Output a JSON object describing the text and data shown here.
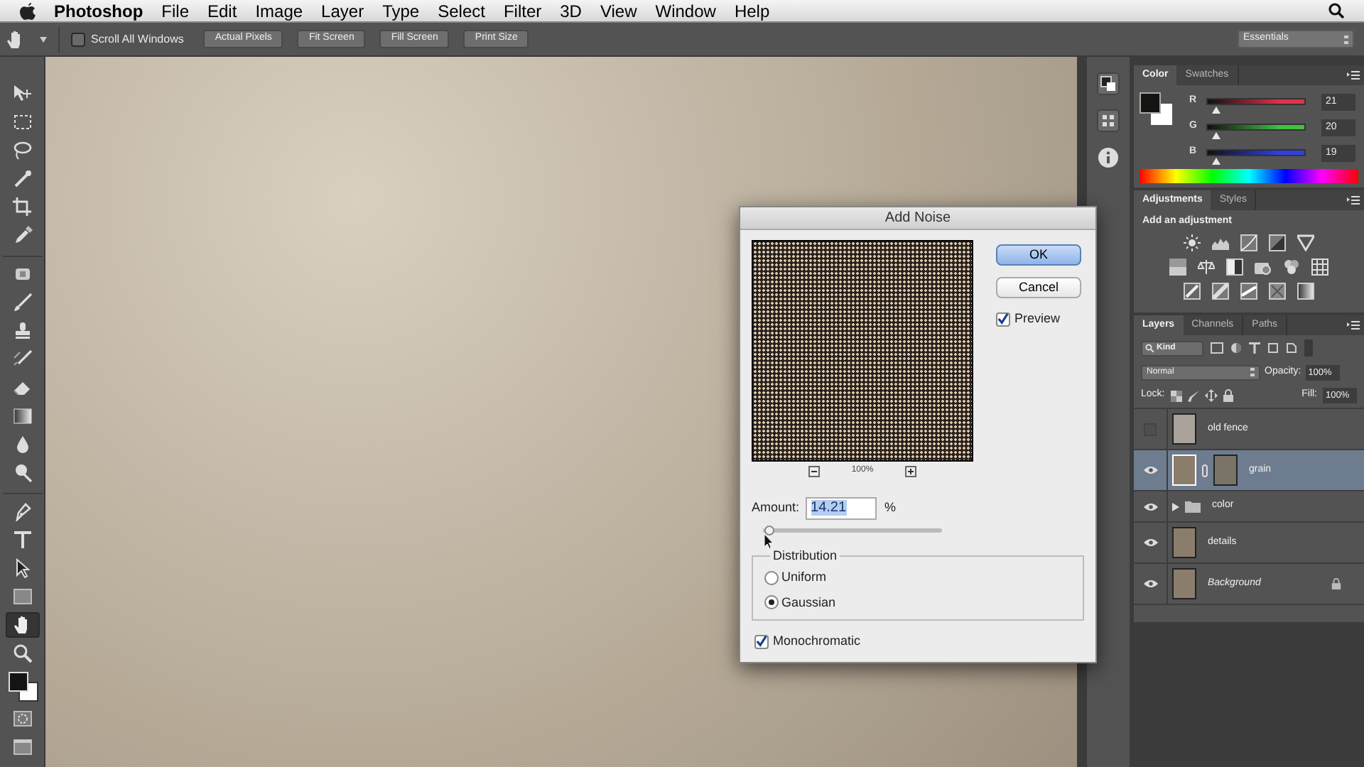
{
  "menu_bar": {
    "items": [
      "Photoshop",
      "File",
      "Edit",
      "Image",
      "Layer",
      "Type",
      "Select",
      "Filter",
      "3D",
      "View",
      "Window",
      "Help"
    ]
  },
  "options_bar": {
    "scroll_all_windows": {
      "label": "Scroll All Windows",
      "checked": false
    },
    "buttons": [
      "Actual Pixels",
      "Fit Screen",
      "Fill Screen",
      "Print Size"
    ],
    "workspace": "Essentials"
  },
  "tools": [
    {
      "kind": "move",
      "selected": false
    },
    {
      "kind": "marquee",
      "selected": false
    },
    {
      "kind": "lasso",
      "selected": false
    },
    {
      "kind": "wand",
      "selected": false
    },
    {
      "kind": "crop",
      "selected": false
    },
    {
      "kind": "eyedropper",
      "selected": false
    },
    {
      "kind": "healing",
      "selected": false
    },
    {
      "kind": "brush",
      "selected": false
    },
    {
      "kind": "stamp",
      "selected": false
    },
    {
      "kind": "historybrush",
      "selected": false
    },
    {
      "kind": "eraser",
      "selected": false
    },
    {
      "kind": "gradient",
      "selected": false
    },
    {
      "kind": "blur",
      "selected": false
    },
    {
      "kind": "dodge",
      "selected": false
    },
    {
      "kind": "pen",
      "selected": false
    },
    {
      "kind": "type",
      "selected": false
    },
    {
      "kind": "pathselect",
      "selected": false
    },
    {
      "kind": "shape",
      "selected": false
    },
    {
      "kind": "hand",
      "selected": true
    },
    {
      "kind": "zoom",
      "selected": false
    }
  ],
  "color_panel": {
    "tabs": [
      {
        "label": "Color",
        "selected": true
      },
      {
        "label": "Swatches",
        "selected": false
      }
    ],
    "channels": [
      {
        "label": "R",
        "value": "21",
        "level": 0.08,
        "color": "#e0304a"
      },
      {
        "label": "G",
        "value": "20",
        "level": 0.08,
        "color": "#40c040"
      },
      {
        "label": "B",
        "value": "19",
        "level": 0.08,
        "color": "#3040e0"
      }
    ]
  },
  "adjustments_panel": {
    "tabs": [
      {
        "label": "Adjustments",
        "selected": true
      },
      {
        "label": "Styles",
        "selected": false
      }
    ],
    "heading": "Add an adjustment"
  },
  "layers_panel": {
    "tabs": [
      {
        "label": "Layers",
        "selected": true
      },
      {
        "label": "Channels",
        "selected": false
      },
      {
        "label": "Paths",
        "selected": false
      }
    ],
    "filter": "Kind",
    "blend_mode": "Normal",
    "opacity_label": "Opacity:",
    "opacity": "100%",
    "lock_label": "Lock:",
    "fill_label": "Fill:",
    "fill": "100%",
    "layers": [
      {
        "name": "old fence",
        "kind": "layer",
        "visible": false,
        "selected": false,
        "mask": false,
        "locked": false
      },
      {
        "name": "grain",
        "kind": "layer",
        "visible": true,
        "selected": true,
        "mask": true,
        "locked": false
      },
      {
        "name": "color",
        "kind": "group",
        "visible": true,
        "selected": false,
        "mask": false,
        "locked": false
      },
      {
        "name": "details",
        "kind": "layer",
        "visible": true,
        "selected": false,
        "mask": false,
        "locked": false
      },
      {
        "name": "Background",
        "kind": "background",
        "visible": true,
        "selected": false,
        "mask": false,
        "locked": true
      }
    ]
  },
  "dialog": {
    "title": "Add Noise",
    "zoom": "100%",
    "amount_label": "Amount:",
    "amount": "14.21",
    "unit": "%",
    "amount_slider": {
      "level": 0.03
    },
    "buttons": [
      {
        "label": "OK",
        "default": true
      },
      {
        "label": "Cancel",
        "default": false
      }
    ],
    "preview": {
      "label": "Preview",
      "checked": true
    },
    "distribution": {
      "legend": "Distribution",
      "options": [
        {
          "label": "Uniform",
          "selected": false
        },
        {
          "label": "Gaussian",
          "selected": true
        }
      ]
    },
    "monochromatic": {
      "label": "Monochromatic",
      "checked": true
    }
  }
}
